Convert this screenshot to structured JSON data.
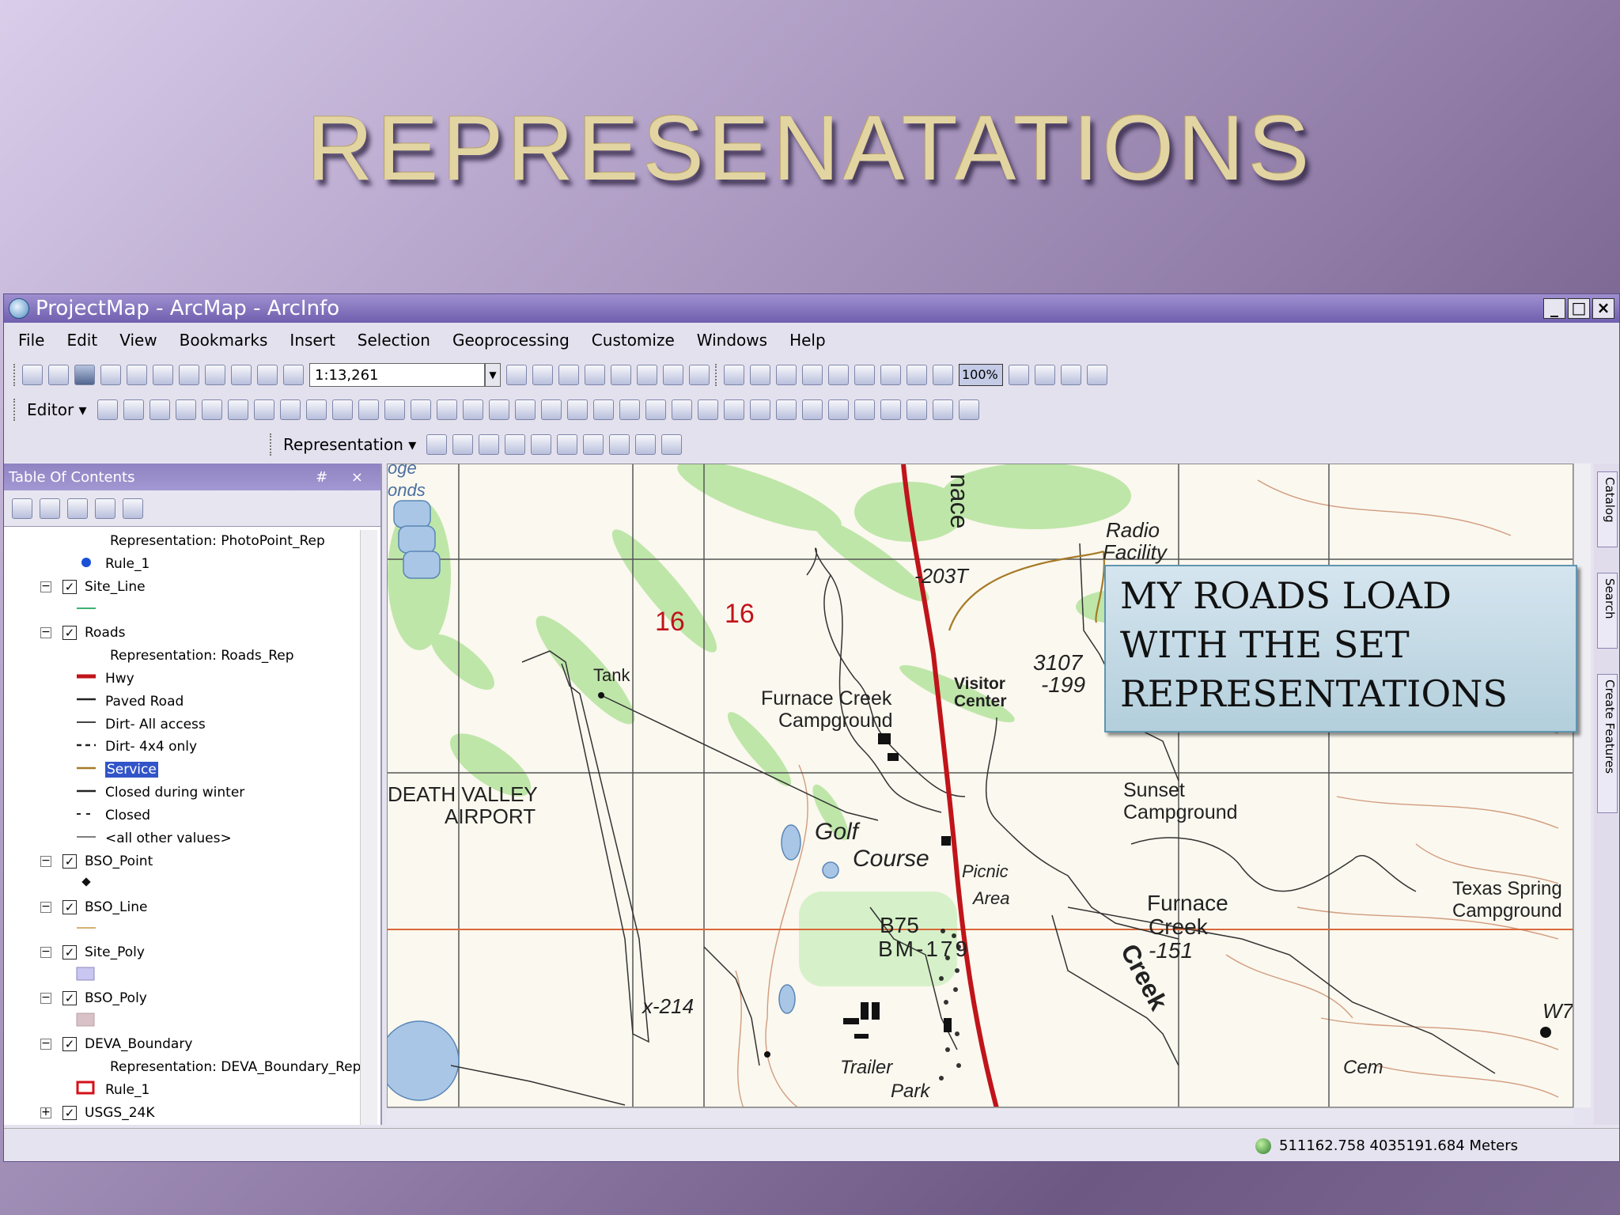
{
  "slide": {
    "title": "REPRESENATATIONS"
  },
  "window": {
    "title": "ProjectMap - ArcMap - ArcInfo",
    "controls": [
      "_",
      "□",
      "×"
    ]
  },
  "menu": [
    "File",
    "Edit",
    "View",
    "Bookmarks",
    "Insert",
    "Selection",
    "Geoprocessing",
    "Customize",
    "Windows",
    "Help"
  ],
  "toolbar": {
    "scale": "1:13,261",
    "zoom": "100%",
    "editor_label": "Editor ▾",
    "representation_label": "Representation ▾"
  },
  "toc": {
    "title": "Table Of Contents",
    "header_controls": "# ×",
    "rows": [
      {
        "type": "rep",
        "label": "Representation: PhotoPoint_Rep"
      },
      {
        "type": "sym",
        "symbol": "dot",
        "label": "Rule_1"
      },
      {
        "type": "layer",
        "label": "Site_Line",
        "checked": "✓",
        "expander": "−"
      },
      {
        "type": "sym",
        "symbol": "green-line",
        "label": ""
      },
      {
        "type": "layer",
        "label": "Roads",
        "checked": "✓",
        "expander": "−"
      },
      {
        "type": "rep",
        "label": "Representation: Roads_Rep"
      },
      {
        "type": "sym",
        "symbol": "red-thick",
        "label": "Hwy"
      },
      {
        "type": "sym",
        "symbol": "solid",
        "label": "Paved Road"
      },
      {
        "type": "sym",
        "symbol": "solid-gray",
        "label": "Dirt- All access"
      },
      {
        "type": "sym",
        "symbol": "dash-4x4",
        "label": "Dirt- 4x4 only"
      },
      {
        "type": "sym",
        "symbol": "service",
        "label": "Service",
        "selected": true
      },
      {
        "type": "sym",
        "symbol": "solid",
        "label": "Closed during winter"
      },
      {
        "type": "sym",
        "symbol": "dashed",
        "label": "Closed"
      },
      {
        "type": "sym",
        "symbol": "thin",
        "label": "<all other values>"
      },
      {
        "type": "layer",
        "label": "BSO_Point",
        "checked": "✓",
        "expander": "−"
      },
      {
        "type": "sym",
        "symbol": "diamond",
        "label": ""
      },
      {
        "type": "layer",
        "label": "BSO_Line",
        "checked": "✓",
        "expander": "−"
      },
      {
        "type": "sym",
        "symbol": "tan-line",
        "label": ""
      },
      {
        "type": "layer",
        "label": "Site_Poly",
        "checked": "✓",
        "expander": "−"
      },
      {
        "type": "sym",
        "symbol": "poly-lavender",
        "label": ""
      },
      {
        "type": "layer",
        "label": "BSO_Poly",
        "checked": "✓",
        "expander": "−"
      },
      {
        "type": "sym",
        "symbol": "poly-pink",
        "label": ""
      },
      {
        "type": "layer",
        "label": "DEVA_Boundary",
        "checked": "✓",
        "expander": "−"
      },
      {
        "type": "rep",
        "label": "Representation: DEVA_Boundary_Rep"
      },
      {
        "type": "sym",
        "symbol": "red-box",
        "label": "Rule_1"
      },
      {
        "type": "layer",
        "label": "USGS_24K",
        "checked": "✓",
        "expander": "+"
      }
    ]
  },
  "side_tabs": [
    "Catalog",
    "Search",
    "Create Features"
  ],
  "map": {
    "labels": {
      "radio": "Radio",
      "facility": "Facility",
      "n203": "-203T",
      "n16a": "16",
      "n16b": "16",
      "tank": "Tank",
      "nace": "nace",
      "furnace1": "Furnace Creek",
      "campground1": "Campground",
      "visitor": "Visitor",
      "center": "Center",
      "n3107": "3107",
      "n199": "-199",
      "dv1": "DEATH VALLEY",
      "dv2": "AIRPORT",
      "sunset1": "Sunset",
      "sunset2": "Campground",
      "golf": "Golf",
      "course": "Course",
      "picnic": "Picnic",
      "area": "Area",
      "furnace2a": "Furnace",
      "furnace2b": "Creek",
      "n151": "-151",
      "creek": "Creek",
      "texas1": "Texas Spring",
      "texas2": "Campground",
      "b75": "B75",
      "bm": "BM-179",
      "n214": "x-214",
      "trailer": "Trailer",
      "park": "Park",
      "cem": "Cem",
      "w": "W7",
      "ponds": "onds",
      "poge": "oge"
    }
  },
  "callout": [
    "MY ROADS LOAD",
    "WITH THE SET",
    "REPRESENTATIONS"
  ],
  "status": {
    "coords": "511162.758  4035191.684 Meters"
  },
  "colors": {
    "accent": "#6f5fae",
    "hwy": "#c0141a",
    "contour": "#b06a3a",
    "veg": "#9ed98a"
  }
}
